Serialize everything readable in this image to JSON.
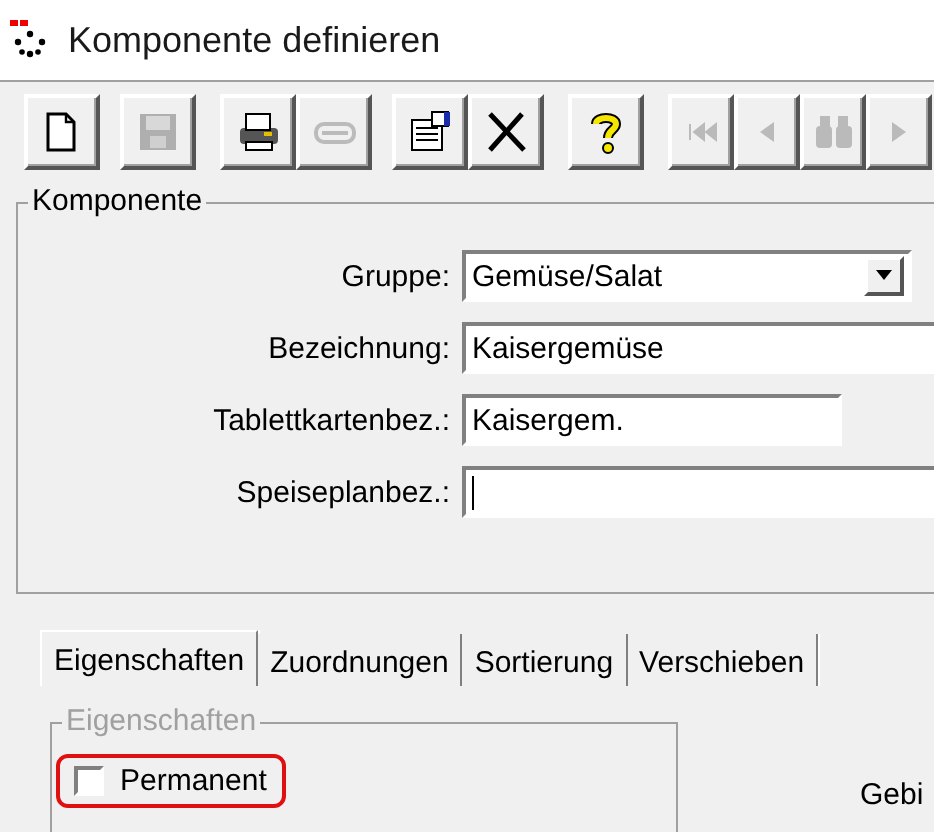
{
  "window": {
    "title": "Komponente definieren"
  },
  "toolbar": [
    {
      "kind": "new",
      "disabled": false
    },
    {
      "kind": "save",
      "disabled": true
    },
    {
      "kind": "print",
      "disabled": false
    },
    {
      "kind": "strip",
      "disabled": true
    },
    {
      "kind": "properties",
      "disabled": false
    },
    {
      "kind": "delete",
      "disabled": false
    },
    {
      "kind": "help",
      "disabled": false
    },
    {
      "kind": "first",
      "disabled": true
    },
    {
      "kind": "previous",
      "disabled": true
    },
    {
      "kind": "find",
      "disabled": true
    },
    {
      "kind": "next",
      "disabled": true
    }
  ],
  "group": {
    "title": "Komponente",
    "fields": [
      {
        "label": "Gruppe:",
        "kind": "combo",
        "value": "Gemüse/Salat",
        "focused": false
      },
      {
        "label": "Bezeichnung:",
        "kind": "text",
        "value": "Kaisergemüse",
        "focused": false
      },
      {
        "label": "Tablettkartenbez.:",
        "kind": "short",
        "value": "Kaisergem.",
        "focused": false
      },
      {
        "label": "Speiseplanbez.:",
        "kind": "text",
        "focused": true
      }
    ]
  },
  "tabs": [
    {
      "label": "Eigenschaften",
      "selected": true
    },
    {
      "label": "Zuordnungen",
      "selected": false
    },
    {
      "label": "Sortierung",
      "selected": false
    },
    {
      "label": "Verschieben",
      "selected": false
    }
  ],
  "panel": {
    "group_title": "Eigenschaften",
    "group_disabled": true,
    "checkbox": {
      "label": "Permanent",
      "checked": false,
      "highlighted": true
    },
    "column_2_label": "Gebi"
  }
}
